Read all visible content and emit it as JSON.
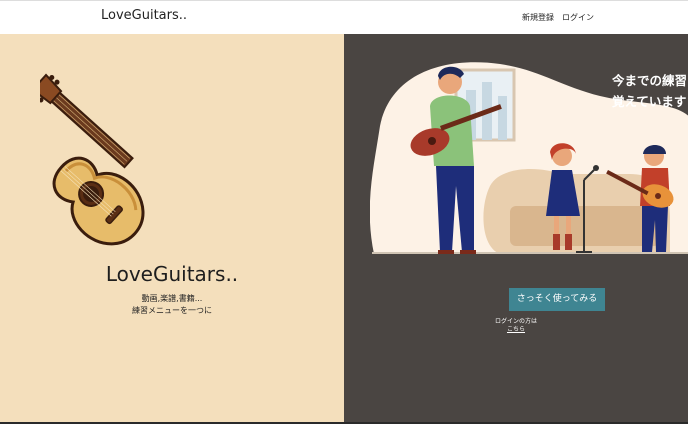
{
  "header": {
    "brand": "LoveGuitars..",
    "nav": {
      "register": "新規登録",
      "login": "ログイン"
    }
  },
  "hero_left": {
    "title": "LoveGuitars..",
    "subtitle_line1": "動画,楽譜,書籍...",
    "subtitle_line2": "練習メニューを一つに",
    "illustration": "acoustic-guitar-icon"
  },
  "hero_right": {
    "headline_line1": "今までの練習",
    "headline_line2": "覚えています",
    "cta_label": "さっそく使ってみる",
    "login_note": "ログインの方は",
    "login_link": "こちら",
    "illustration": "family-playing-guitar-illustration"
  },
  "colors": {
    "left_bg": "#f4dfbc",
    "right_bg": "#4a4542",
    "cta_bg": "#3f8592"
  }
}
